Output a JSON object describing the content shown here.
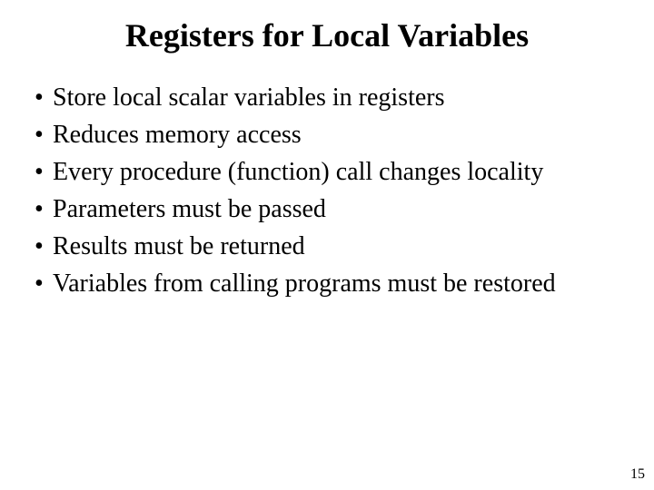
{
  "slide": {
    "title": "Registers for Local Variables",
    "bullets": [
      "Store local scalar variables in registers",
      "Reduces memory access",
      "Every procedure (function) call changes locality",
      "Parameters must be passed",
      "Results must be returned",
      "Variables from calling programs must be restored"
    ],
    "page_number": "15"
  }
}
